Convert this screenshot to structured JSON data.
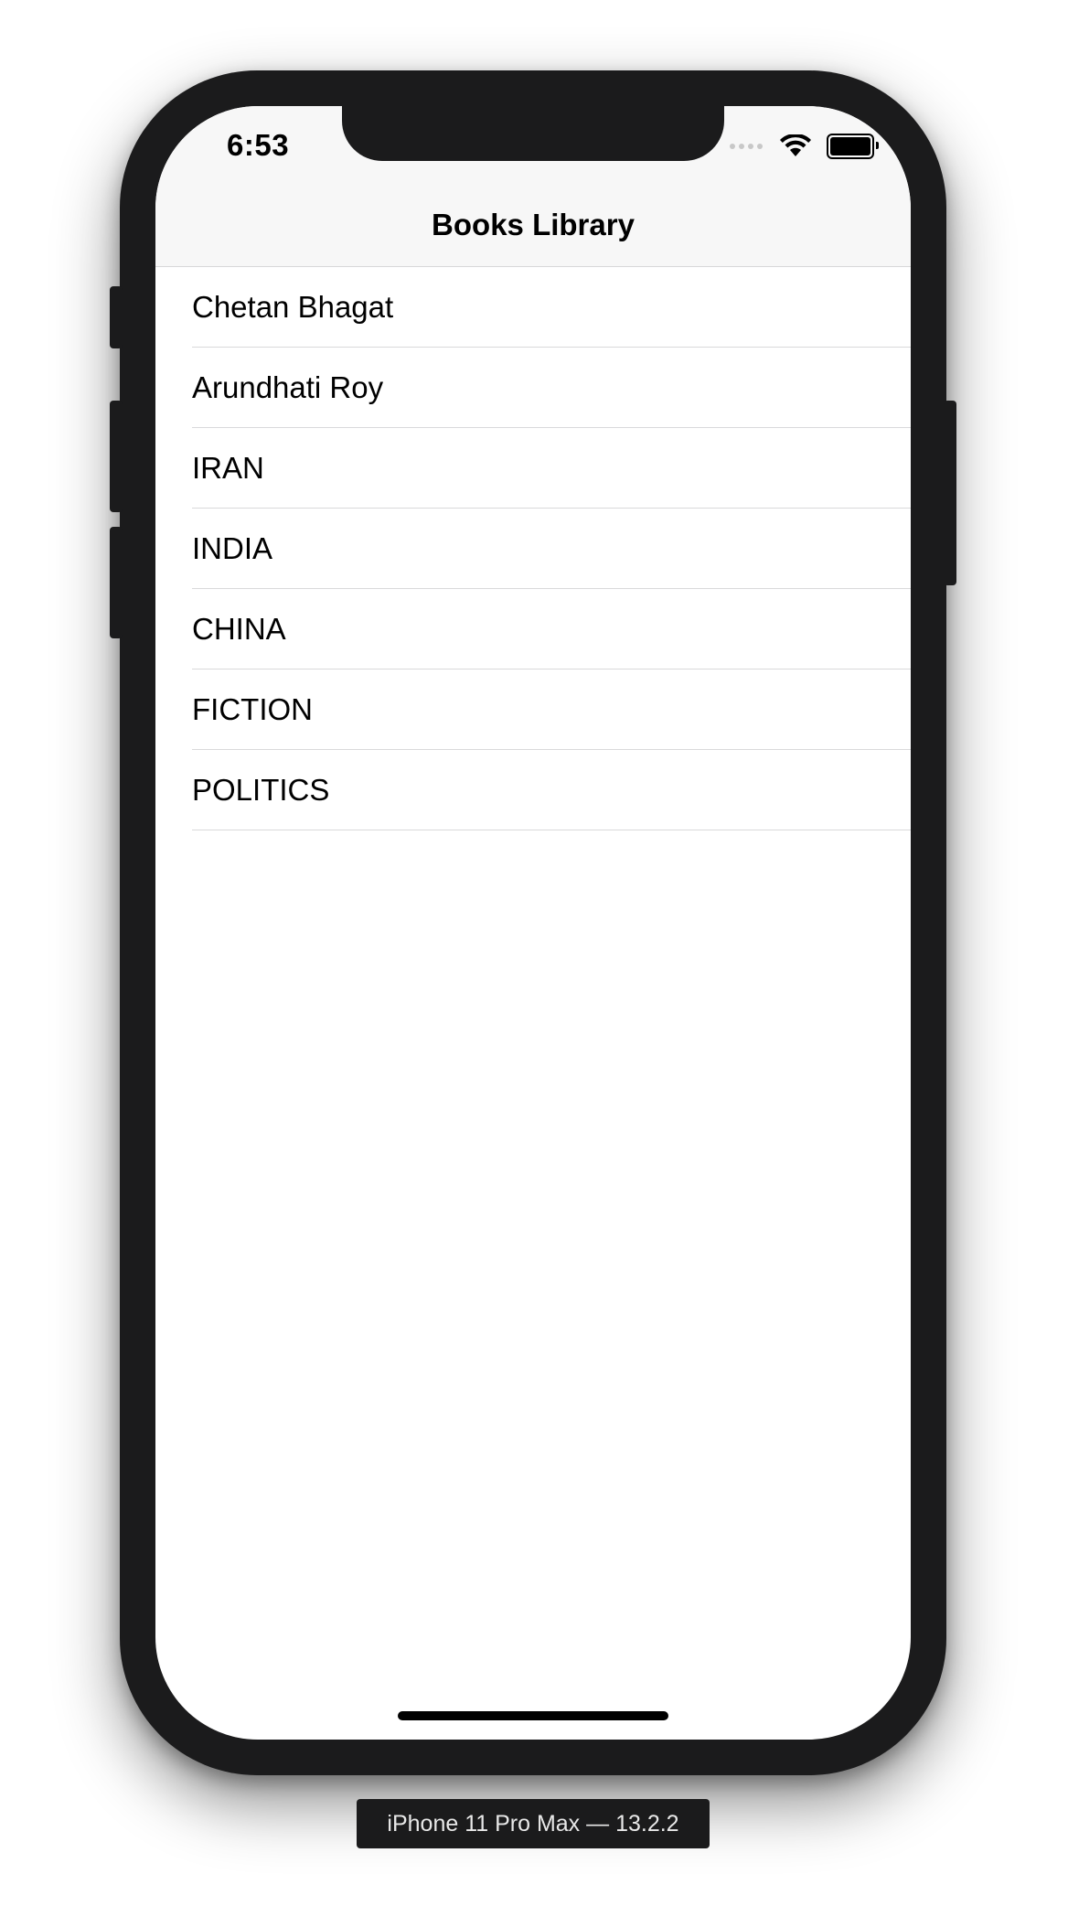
{
  "status_bar": {
    "time": "6:53",
    "icons": [
      "cellular-signal-icon",
      "wifi-icon",
      "battery-icon"
    ]
  },
  "nav": {
    "title": "Books Library"
  },
  "list": {
    "items": [
      {
        "label": "Chetan Bhagat"
      },
      {
        "label": "Arundhati Roy"
      },
      {
        "label": "IRAN"
      },
      {
        "label": "INDIA"
      },
      {
        "label": "CHINA"
      },
      {
        "label": "FICTION"
      },
      {
        "label": "POLITICS"
      }
    ]
  },
  "simulator": {
    "device_label": "iPhone 11 Pro Max — 13.2.2"
  },
  "colors": {
    "device_frame": "#1b1b1c",
    "nav_background": "#f7f7f7",
    "separator": "#d9d9db",
    "text": "#000000"
  }
}
